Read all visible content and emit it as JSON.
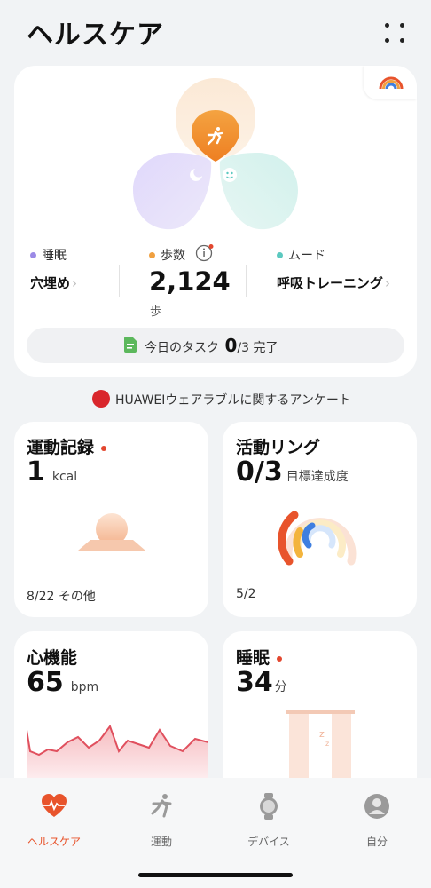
{
  "header": {
    "title": "ヘルスケア"
  },
  "summary": {
    "sleep": {
      "label": "睡眠",
      "value": "穴埋め",
      "color": "#9b8ae6"
    },
    "steps": {
      "label": "歩数",
      "value": "2,124",
      "unit": "歩",
      "color": "#f0a040"
    },
    "mood": {
      "label": "ムード",
      "value": "呼吸トレーニング",
      "color": "#5cc9c0"
    },
    "task": {
      "label": "今日のタスク",
      "done": "0",
      "total": "/3",
      "suffix": "完了"
    }
  },
  "survey": {
    "text": "HUAWEIウェアラブルに関するアンケート"
  },
  "cards": {
    "exercise": {
      "title": "運動記録",
      "value": "1",
      "unit": "kcal",
      "footer": "8/22 その他"
    },
    "activity": {
      "title": "活動リング",
      "value": "0/3",
      "unit": "目標達成度",
      "footer": "5/2"
    },
    "heart": {
      "title": "心機能",
      "value": "65",
      "unit": "bpm"
    },
    "sleep": {
      "title": "睡眠",
      "value": "34",
      "unit": "分"
    }
  },
  "nav": [
    {
      "label": "ヘルスケア",
      "icon": "heart-pulse-icon",
      "active": true
    },
    {
      "label": "運動",
      "icon": "running-icon",
      "active": false
    },
    {
      "label": "デバイス",
      "icon": "watch-icon",
      "active": false
    },
    {
      "label": "自分",
      "icon": "profile-icon",
      "active": false
    }
  ],
  "colors": {
    "accent": "#e8542c",
    "sleep": "#9b8ae6",
    "steps": "#f0a040",
    "mood": "#5cc9c0"
  }
}
